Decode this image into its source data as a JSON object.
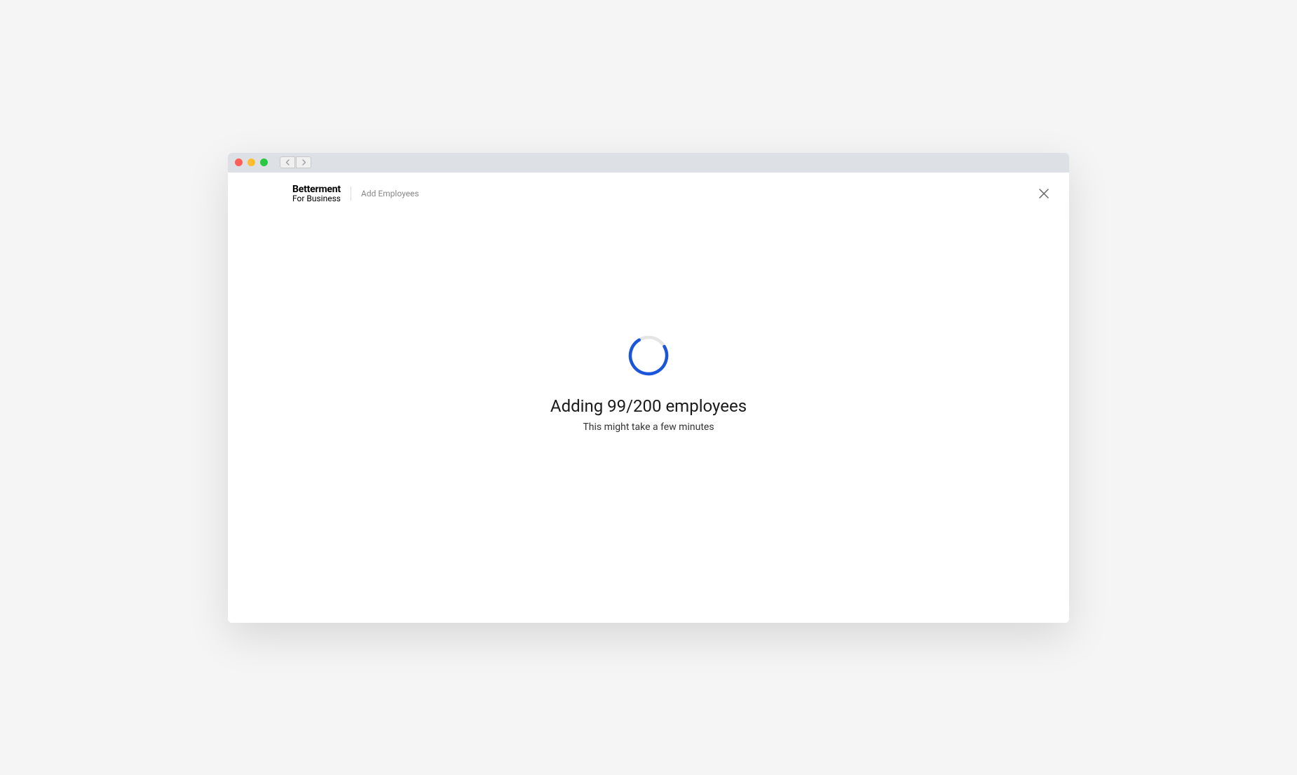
{
  "header": {
    "logo_main": "Betterment",
    "logo_sub": "For Business",
    "breadcrumb": "Add Employees"
  },
  "progress": {
    "current": 99,
    "total": 200,
    "title": "Adding 99/200 employees",
    "subtitle": "This might take a few minutes"
  },
  "colors": {
    "spinner_accent": "#1a56db",
    "spinner_track": "#e5e5e5"
  }
}
